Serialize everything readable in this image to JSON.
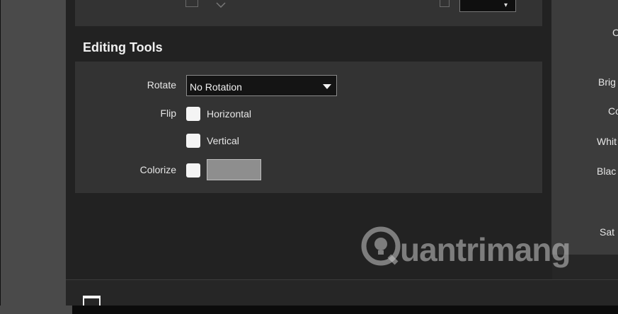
{
  "section": {
    "title": "Editing Tools"
  },
  "rotate": {
    "label": "Rotate",
    "value": "No Rotation"
  },
  "flip": {
    "label": "Flip",
    "horizontal_label": "Horizontal",
    "vertical_label": "Vertical"
  },
  "colorize": {
    "label": "Colorize",
    "swatch_color": "#8e8e8e"
  },
  "right_panel": {
    "labels": [
      "C",
      "Brig",
      "Co",
      "Whit",
      "Blac",
      "Sat"
    ]
  },
  "watermark": {
    "text": "uantrimang"
  }
}
